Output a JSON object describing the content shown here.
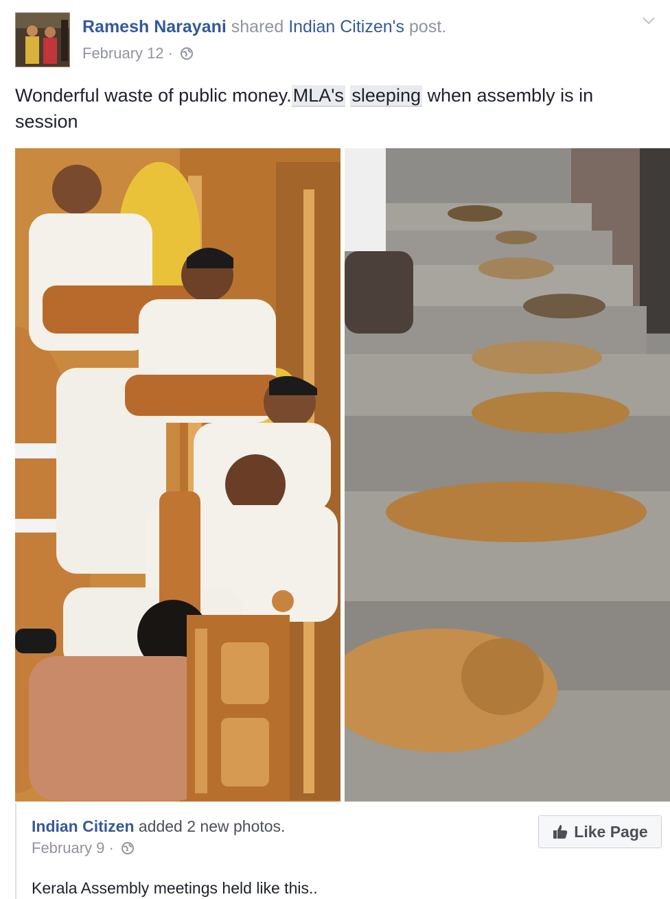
{
  "post": {
    "author_name": "Ramesh Narayani",
    "action_text": "shared",
    "shared_from": "Indian Citizen's",
    "post_word": "post.",
    "timestamp": "February 12",
    "separator": "·",
    "message_part1": "Wonderful waste of public money.",
    "message_tag1": "MLA's",
    "message_part2": " ",
    "message_tag2": "sleeping",
    "message_part3": " when assembly is in session"
  },
  "shared_post": {
    "author_name": "Indian Citizen",
    "action_text": "added 2 new photos.",
    "timestamp": "February 9",
    "separator": "·",
    "text": "Kerala Assembly meetings held like this..",
    "like_button_label": "Like Page"
  },
  "icons": {
    "audience": "globe-icon",
    "options": "chevron-down-icon",
    "like": "thumbs-up-icon"
  },
  "colors": {
    "link": "#365899",
    "meta": "#90949c",
    "text": "#1d2129"
  }
}
